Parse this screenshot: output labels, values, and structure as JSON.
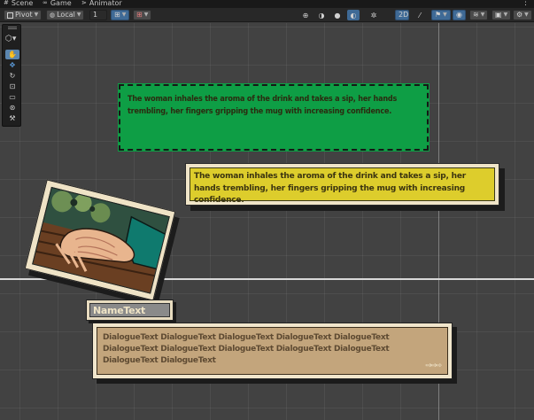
{
  "tabs": [
    {
      "label": "Scene",
      "icon": "hash-icon"
    },
    {
      "label": "Game",
      "icon": "gamepad-icon"
    },
    {
      "label": "Animator",
      "icon": "animator-icon"
    }
  ],
  "toolbar": {
    "pivot_label": "Pivot",
    "local_label": "Local",
    "increment_value": "1",
    "mode_2d_label": "2D"
  },
  "tools": [
    "hand-tool",
    "move-tool",
    "rotate-tool",
    "scale-tool",
    "rect-tool",
    "transform-tool",
    "custom-tool"
  ],
  "scene": {
    "green_box_text": "The woman inhales the aroma of the drink and takes a sip, her hands trembling, her fingers gripping the mug with increasing confidence.",
    "yellow_box_text": "The woman inhales the aroma of the drink and takes a sip, her hands trembling, her fingers gripping the mug with increasing confidence.",
    "name_text": "NameText",
    "dialogue_text": "DialogueText DialogueText DialogueText DialogueText DialogueText DialogueText DialogueText DialogueText DialogueText DialogueText DialogueText DialogueText",
    "next_arrow": "⇨⇨⇨"
  },
  "colors": {
    "scene_bg": "#424242",
    "green_box": "#0e9e45",
    "yellow_box": "#ddcd2c",
    "paper": "#f0e5c8",
    "dialogue_bg": "#c3a57c",
    "accent_blue": "#3f6a96"
  }
}
